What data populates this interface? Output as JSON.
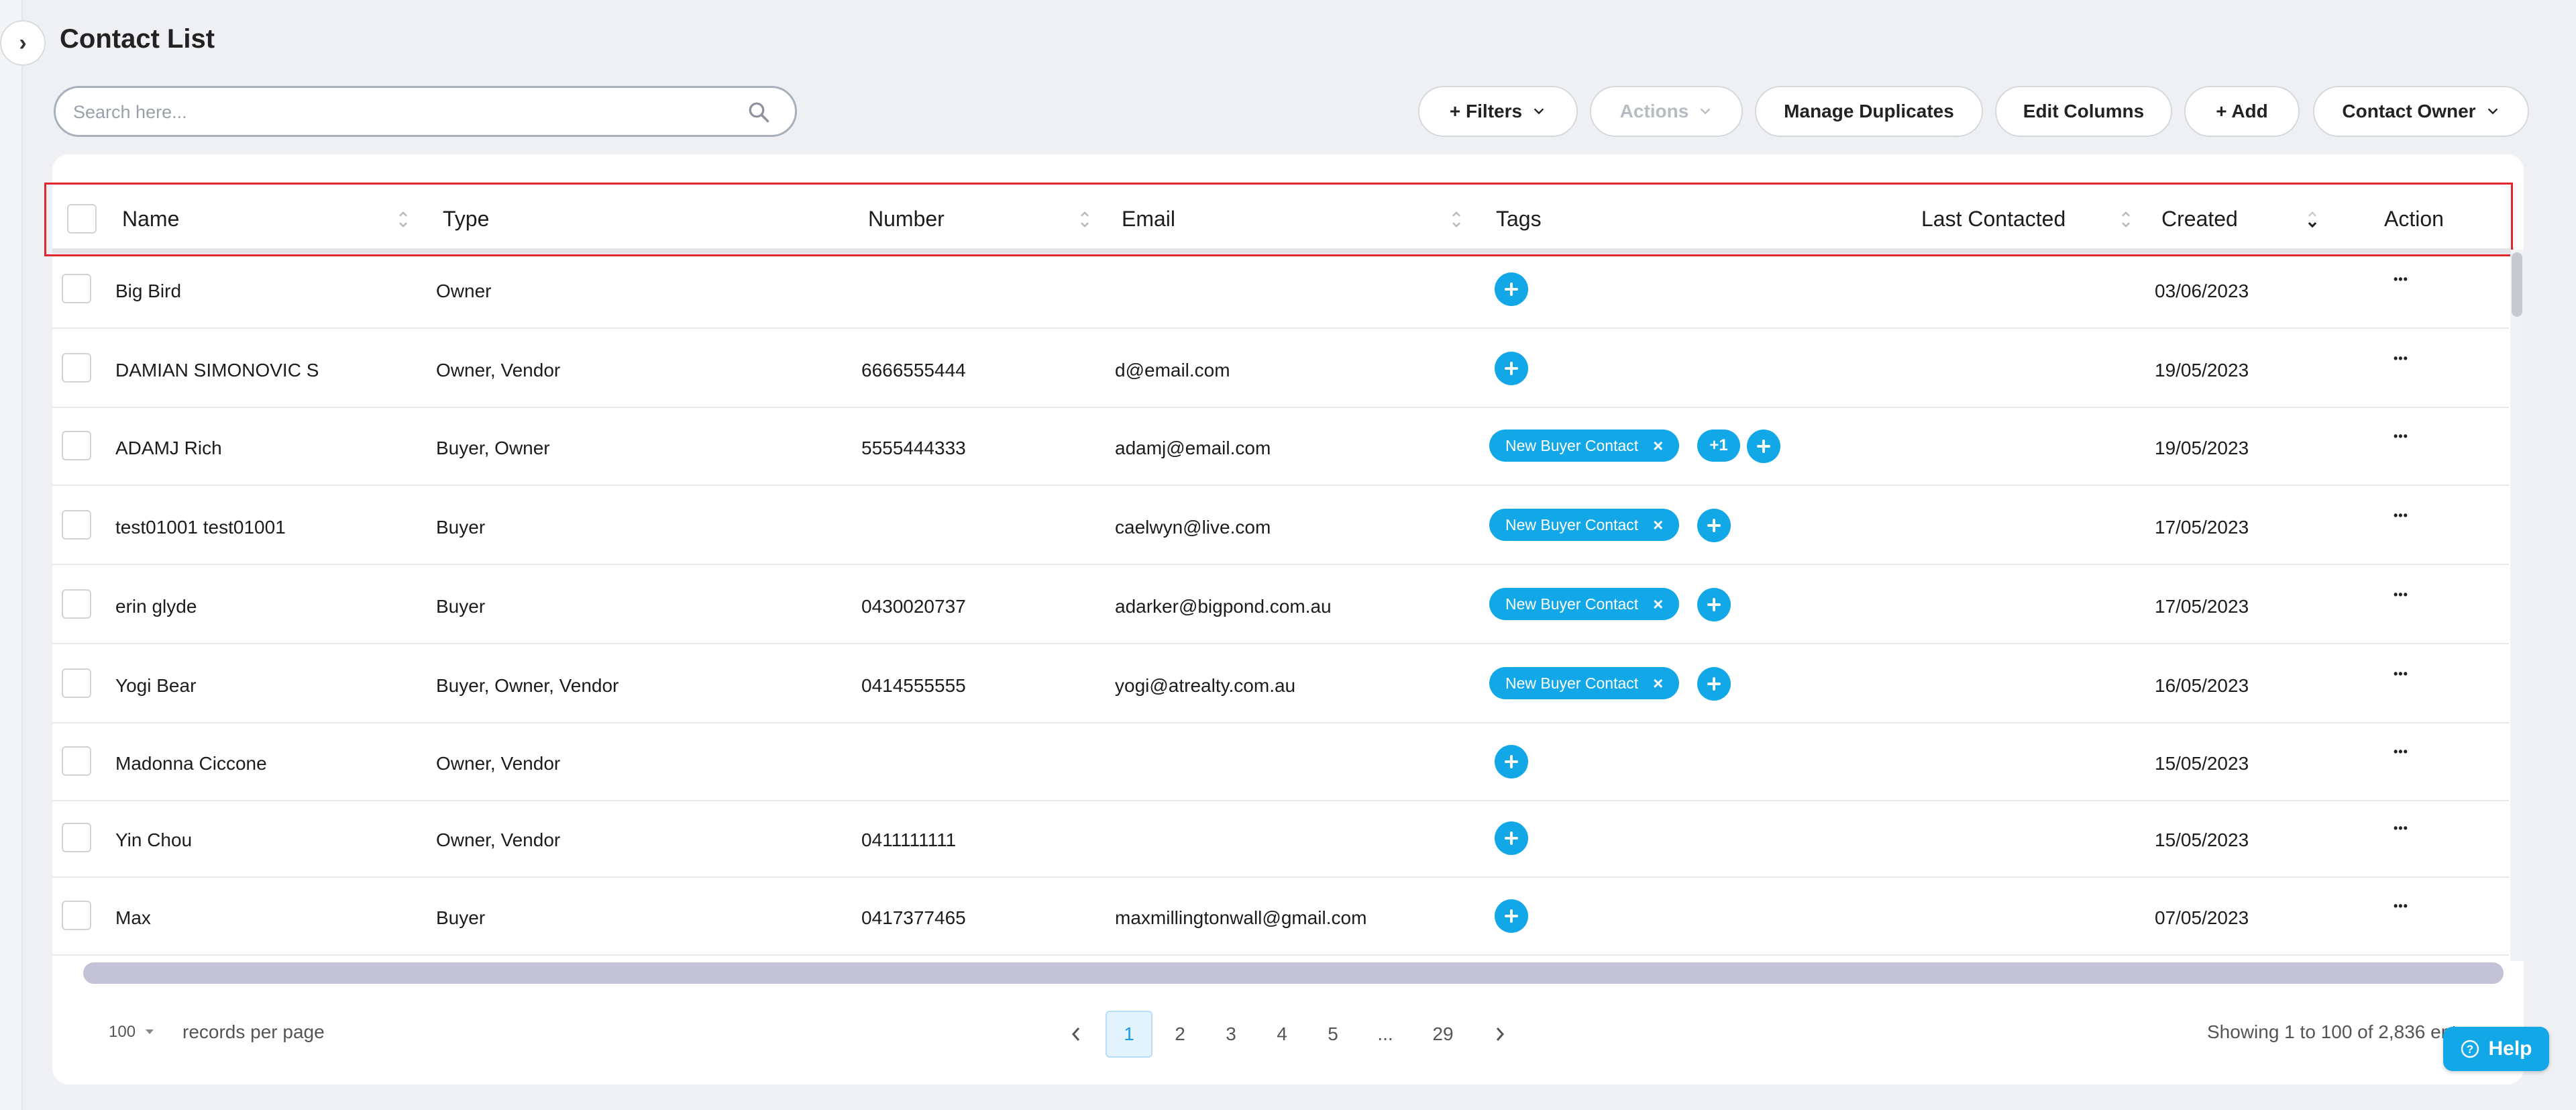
{
  "page": {
    "title": "Contact List"
  },
  "search": {
    "placeholder": "Search here..."
  },
  "toolbar": {
    "filters_label": "+ Filters",
    "actions_label": "Actions",
    "manage_duplicates_label": "Manage Duplicates",
    "edit_columns_label": "Edit Columns",
    "add_label": "+ Add",
    "contact_owner_label": "Contact Owner"
  },
  "table": {
    "columns": [
      "Name",
      "Type",
      "Number",
      "Email",
      "Tags",
      "Last Contacted",
      "Created",
      "Action"
    ],
    "rows": [
      {
        "name": "Big Bird",
        "type": "Owner",
        "number": "",
        "email": "",
        "tags": [],
        "extra_tags": "",
        "created": "03/06/2023"
      },
      {
        "name": "DAMIAN SIMONOVIC S",
        "type": "Owner, Vendor",
        "number": "6666555444",
        "email": "d@email.com",
        "tags": [],
        "extra_tags": "",
        "created": "19/05/2023"
      },
      {
        "name": "ADAMJ Rich",
        "type": "Buyer, Owner",
        "number": "5555444333",
        "email": "adamj@email.com",
        "tags": [
          "New Buyer Contact"
        ],
        "extra_tags": "+1",
        "created": "19/05/2023"
      },
      {
        "name": "test01001 test01001",
        "type": "Buyer",
        "number": "",
        "email": "caelwyn@live.com",
        "tags": [
          "New Buyer Contact"
        ],
        "extra_tags": "",
        "created": "17/05/2023"
      },
      {
        "name": "erin glyde",
        "type": "Buyer",
        "number": "0430020737",
        "email": "adarker@bigpond.com.au",
        "tags": [
          "New Buyer Contact"
        ],
        "extra_tags": "",
        "created": "17/05/2023"
      },
      {
        "name": "Yogi Bear",
        "type": "Buyer, Owner, Vendor",
        "number": "0414555555",
        "email": "yogi@atrealty.com.au",
        "tags": [
          "New Buyer Contact"
        ],
        "extra_tags": "",
        "created": "16/05/2023"
      },
      {
        "name": "Madonna Ciccone",
        "type": "Owner, Vendor",
        "number": "",
        "email": "",
        "tags": [],
        "extra_tags": "",
        "created": "15/05/2023"
      },
      {
        "name": "Yin Chou",
        "type": "Owner, Vendor",
        "number": "0411111111",
        "email": "",
        "tags": [],
        "extra_tags": "",
        "created": "15/05/2023"
      },
      {
        "name": "Max",
        "type": "Buyer",
        "number": "0417377465",
        "email": "maxmillingtonwall@gmail.com",
        "tags": [],
        "extra_tags": "",
        "created": "07/05/2023"
      }
    ]
  },
  "pagination": {
    "per_page_value": "100",
    "per_page_label": "records per page",
    "pages": [
      "1",
      "2",
      "3",
      "4",
      "5",
      "...",
      "29"
    ],
    "current_page": "1",
    "showing_text": "Showing 1 to 100 of 2,836 ent"
  },
  "help": {
    "label": "Help"
  },
  "colors": {
    "accent": "#12a8e8",
    "highlight_border": "#e1262d"
  },
  "icons": {
    "sidebar_toggle": "chevron-right-icon",
    "search": "search-icon",
    "dropdown": "chevron-down-icon",
    "add_tag": "plus-circle-icon",
    "remove_tag": "close-icon",
    "row_action": "more-horizontal-icon",
    "sort": "sort-icon",
    "help": "question-circle-icon"
  }
}
